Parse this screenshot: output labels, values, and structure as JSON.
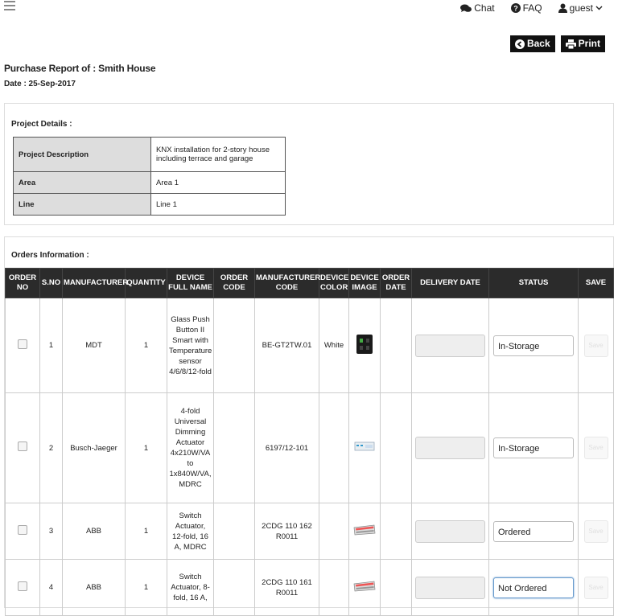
{
  "header": {
    "menu_icon": "hamburger-icon",
    "nav": [
      {
        "label": "Chat",
        "icon": "chat-icon"
      },
      {
        "label": "FAQ",
        "icon": "question-circle-icon"
      },
      {
        "label": "guest",
        "icon": "user-icon"
      }
    ]
  },
  "actions": {
    "back_label": "Back",
    "print_label": "Print"
  },
  "report": {
    "title": "Purchase Report of : Smith House",
    "date": "Date : 25-Sep-2017"
  },
  "project": {
    "heading": "Project Details :",
    "rows": [
      {
        "label": "Project Description",
        "value": "KNX installation for 2-story house including terrace and garage"
      },
      {
        "label": "Area",
        "value": "Area 1"
      },
      {
        "label": "Line",
        "value": "Line 1"
      }
    ]
  },
  "orders": {
    "heading": "Orders Information :",
    "columns": [
      "ORDER NO",
      "S.NO",
      "MANUFACTURER",
      "QUANTITY",
      "DEVICE FULL NAME",
      "ORDER CODE",
      "MANUFACTURER CODE",
      "DEVICE COLOR",
      "DEVICE IMAGE",
      "ORDER DATE",
      "DELIVERY DATE",
      "STATUS",
      "SAVE"
    ],
    "save_label": "Save",
    "rows": [
      {
        "sno": "1",
        "manufacturer": "MDT",
        "quantity": "1",
        "device_name": "Glass Push Button II Smart with Temperature sensor 4/6/8/12-fold",
        "order_code": "",
        "manufacturer_code": "BE-GT2TW.01",
        "color": "White",
        "order_date": "",
        "status": "In-Storage"
      },
      {
        "sno": "2",
        "manufacturer": "Busch-Jaeger",
        "quantity": "1",
        "device_name": "4-fold Universal Dimming Actuator 4x210W/VA to 1x840W/VA, MDRC",
        "order_code": "",
        "manufacturer_code": "6197/12-101",
        "color": "",
        "order_date": "",
        "status": "In-Storage"
      },
      {
        "sno": "3",
        "manufacturer": "ABB",
        "quantity": "1",
        "device_name": "Switch Actuator, 12-fold, 16 A, MDRC",
        "order_code": "",
        "manufacturer_code": "2CDG 110 162 R0011",
        "color": "",
        "order_date": "",
        "status": "Ordered"
      },
      {
        "sno": "4",
        "manufacturer": "ABB",
        "quantity": "1",
        "device_name": "Switch Actuator, 8-fold, 16 A,",
        "order_code": "",
        "manufacturer_code": "2CDG 110 161 R0011",
        "color": "",
        "order_date": "",
        "status": "Not Ordered"
      }
    ]
  }
}
